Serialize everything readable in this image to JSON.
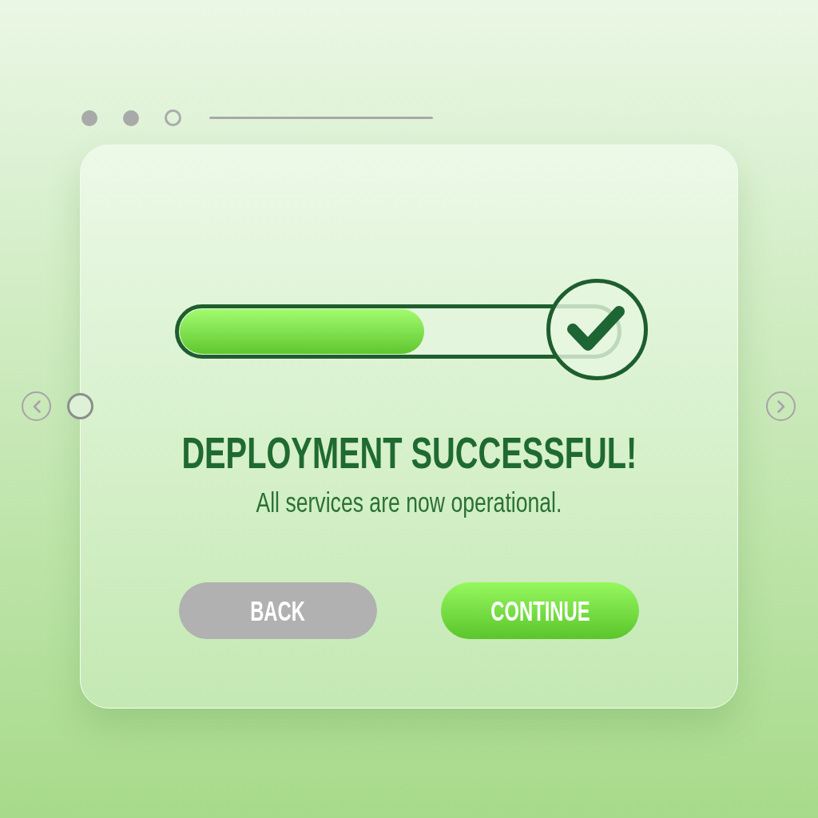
{
  "window_controls": {
    "steps": [
      {
        "filled": true
      },
      {
        "filled": true
      },
      {
        "filled": false
      }
    ]
  },
  "progress": {
    "level": 0.56,
    "complete": true
  },
  "title": "DEPLOYMENT SUCCESSFUL!",
  "message": "All services are now operational.",
  "buttons": [
    {
      "label": "BACK",
      "kind": "secondary"
    },
    {
      "label": "CONTINUE",
      "kind": "primary"
    }
  ]
}
